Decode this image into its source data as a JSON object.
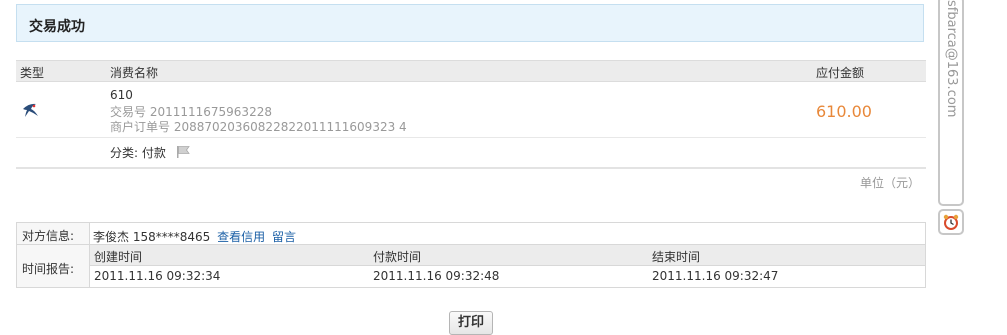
{
  "banner": {
    "title": "交易成功"
  },
  "table": {
    "headers": {
      "type": "类型",
      "name": "消费名称",
      "amount": "应付金额"
    },
    "item": {
      "icon": "bird-logo-icon",
      "name": "610",
      "trade_no": "交易号 2011111675963228",
      "order_no": "商户订单号 20887020360822822011111609323 4",
      "amount": "610.00",
      "category": "分类: 付款",
      "category_icon": "flag-icon"
    },
    "unit": "单位（元）"
  },
  "info": {
    "party_label": "对方信息:",
    "party_value": "李俊杰 158****8465",
    "credit_link": "查看信用",
    "message_link": "留言",
    "time_label": "时间报告:",
    "time_headers": [
      "创建时间",
      "付款时间",
      "结束时间"
    ],
    "time_values": [
      "2011.11.16 09:32:34",
      "2011.11.16 09:32:48",
      "2011.11.16 09:32:47"
    ]
  },
  "print_button": "打印",
  "side": {
    "email": "sfbarca@163.com",
    "icon": "alarm-clock-icon"
  },
  "colors": {
    "amount": "#e8883a",
    "link": "#1c60a6",
    "banner_bg": "#e8f4fc"
  }
}
